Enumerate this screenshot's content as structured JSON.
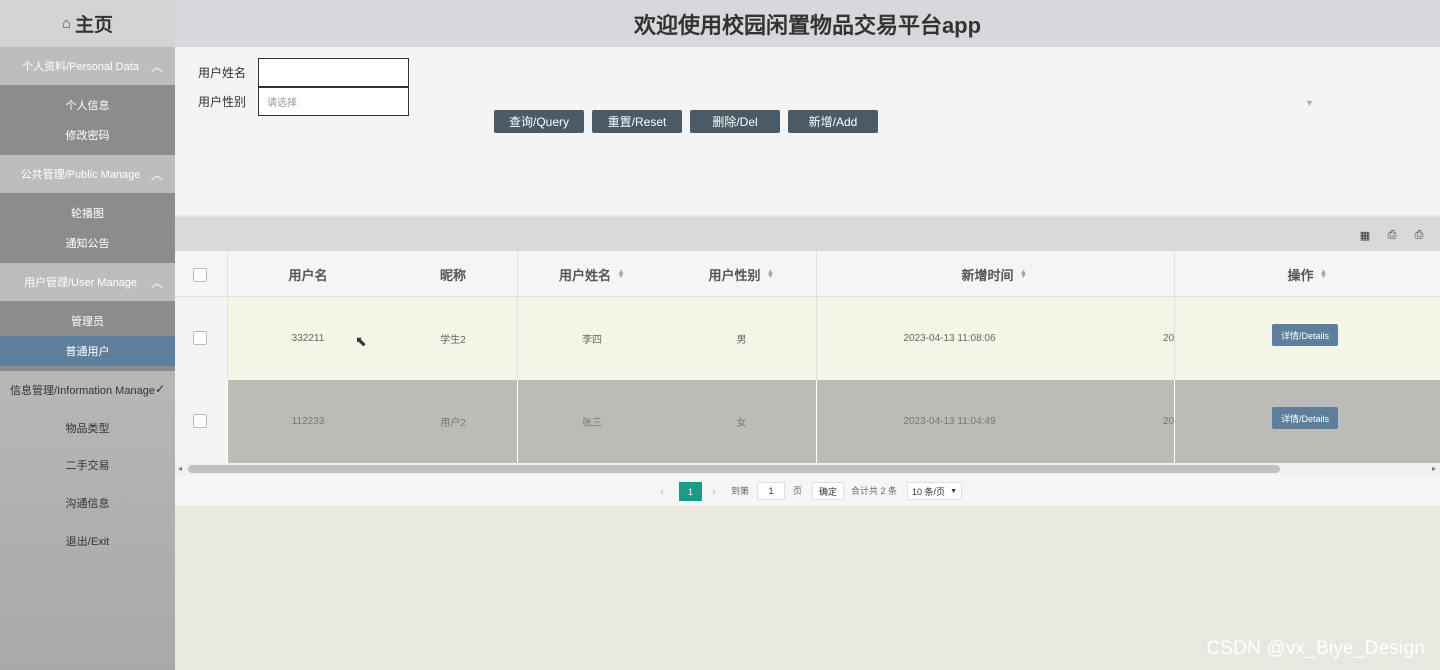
{
  "header": {
    "title": "欢迎使用校园闲置物品交易平台app"
  },
  "sidebar": {
    "home_label": "主页",
    "groups": [
      {
        "label": "个人资料/Personal Data",
        "items": [
          "个人信息",
          "修改密码"
        ]
      },
      {
        "label": "公共管理/Public Manage",
        "items": [
          "轮播图",
          "通知公告"
        ]
      },
      {
        "label": "用户管理/User Manage",
        "items": [
          "管理员",
          "普通用户"
        ]
      },
      {
        "label": "信息管理/Information Manage",
        "items": [
          "物品类型",
          "二手交易",
          "沟通信息"
        ]
      }
    ],
    "exit_label": "退出/Exit",
    "active_item": "普通用户"
  },
  "search": {
    "name_label": "用户姓名",
    "name_value": "",
    "gender_label": "用户性别",
    "gender_placeholder": "请选择"
  },
  "buttons": {
    "query": "查询/Query",
    "reset": "重置/Reset",
    "delete": "删除/Del",
    "add": "新增/Add"
  },
  "table": {
    "columns": [
      "用户名",
      "昵称",
      "用户姓名",
      "用户性别",
      "新增时间",
      "操作"
    ],
    "rows": [
      {
        "username": "332211",
        "nickname": "学生2",
        "real_name": "李四",
        "gender": "男",
        "created": "2023-04-13 11:08:06",
        "extra": "20",
        "action": "详情/Details"
      },
      {
        "username": "112233",
        "nickname": "用户2",
        "real_name": "张三",
        "gender": "女",
        "created": "2023-04-13 11:04:49",
        "extra": "20",
        "action": "详情/Details"
      }
    ]
  },
  "pagination": {
    "current_page": "1",
    "goto_prefix": "到第",
    "goto_value": "1",
    "goto_suffix": "页",
    "confirm_label": "确定",
    "total_text": "合计共 2 条",
    "page_size": "10 条/页"
  },
  "watermark": "CSDN @vx_Biye_Design",
  "colors": {
    "active_nav": "#5d7f9b",
    "button": "#4a5a66",
    "page_active": "#1c9a87",
    "row_highlight": "#f4f5e6",
    "row_alt": "#bdbbb7"
  }
}
